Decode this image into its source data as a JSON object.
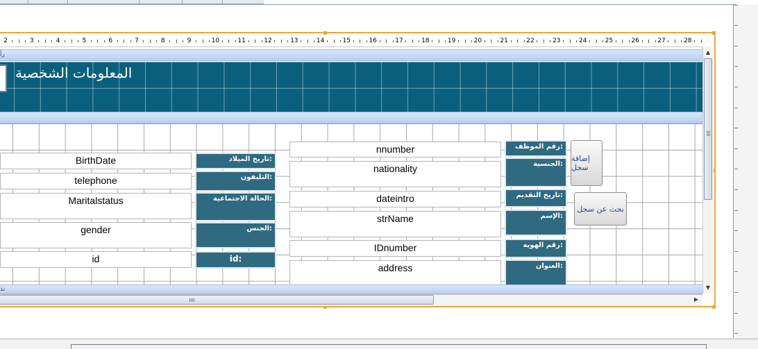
{
  "header": {
    "title": "المعلومات الشخصية",
    "section_label_top": "رأ",
    "section_label_bottom": "تذ"
  },
  "ruler": {
    "numbers": [
      "2",
      "3",
      "4",
      "5",
      "6",
      "7",
      "8",
      "9",
      "10",
      "11",
      "12",
      "13",
      "14",
      "15",
      "16",
      "17",
      "18",
      "19",
      "20",
      "21",
      "22",
      "23",
      "24",
      "25",
      "26",
      "27",
      "28"
    ]
  },
  "fields": {
    "birthdate": "BirthDate",
    "telephone": "telephone",
    "maritalstatus": "Maritalstatus",
    "gender": "gender",
    "id": "id",
    "nnumber": "nnumber",
    "nationality": "nationality",
    "dateintro": "dateintro",
    "strname": "strName",
    "idnumber": "IDnumber",
    "address": "address"
  },
  "labels": {
    "birthdate": "تاريخ الميلاد:",
    "telephone": "التليفون:",
    "maritalstatus": "الحالة الاجتماعية:",
    "gender": "الجنس:",
    "id": "id:",
    "nnumber": "رقم الموظف:",
    "nationality": "الجنسية:",
    "dateintro": "تاريخ التقديم:",
    "strname": "الإسم:",
    "idnumber": "رقم الهويه:",
    "address": "العنوان:"
  },
  "buttons": {
    "add_record": "إضافة سجل",
    "search_record": "بحث عن سجل"
  },
  "icons": {
    "scroll_up": "scroll-up-arrow-icon",
    "scroll_down": "scroll-down-arrow-icon",
    "scroll_right": "scroll-right-arrow-icon"
  },
  "colors": {
    "header_bg": "#0a607c",
    "label_bg": "#2f6a80",
    "selection": "#f0a63a",
    "section_bar": "#c8dbf5"
  }
}
